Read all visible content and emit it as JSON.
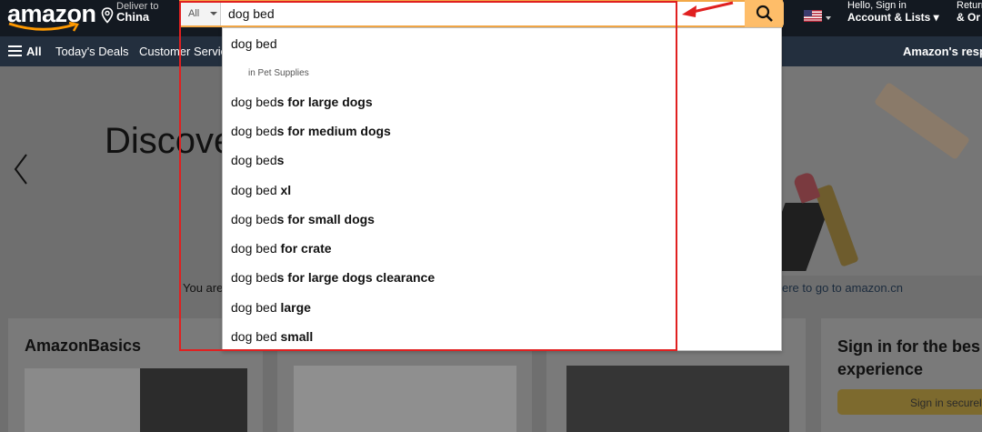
{
  "header": {
    "logo_text": "amazon",
    "deliver_label": "Deliver to",
    "deliver_location": "China",
    "search": {
      "category": "All",
      "value": "dog bed",
      "button_icon": "search-icon"
    },
    "flag_icon": "us-flag-icon",
    "account_line1": "Hello, Sign in",
    "account_line2": "Account & Lists",
    "returns_line1": "Return",
    "returns_line2": "& Or"
  },
  "nav": {
    "all_label": "All",
    "links": [
      "Today's Deals",
      "Customer Servic"
    ],
    "right_text": "Amazon's resp"
  },
  "hero": {
    "headline": "Discove",
    "left_text": "You are",
    "right_text": "ere to go to amazon.cn"
  },
  "cards": {
    "basics_title": "AmazonBasics",
    "signin_title": "Sign in for the bes experience",
    "signin_button": "Sign in securel"
  },
  "autocomplete": [
    {
      "prefix": "dog bed",
      "suffix": ""
    },
    {
      "sub": "in Pet Supplies"
    },
    {
      "prefix": "dog bed",
      "suffix": "s for large dogs"
    },
    {
      "prefix": "dog bed",
      "suffix": "s for medium dogs"
    },
    {
      "prefix": "dog bed",
      "suffix": "s"
    },
    {
      "prefix": "dog bed ",
      "suffix": "xl"
    },
    {
      "prefix": "dog bed",
      "suffix": "s for small dogs"
    },
    {
      "prefix": "dog bed ",
      "suffix": "for crate"
    },
    {
      "prefix": "dog bed",
      "suffix": "s for large dogs clearance"
    },
    {
      "prefix": "dog bed ",
      "suffix": "large"
    },
    {
      "prefix": "dog bed ",
      "suffix": "small"
    }
  ],
  "colors": {
    "nav_dark": "#131921",
    "nav_secondary": "#232f3e",
    "search_button": "#febd69",
    "highlight_box": "#e02020"
  }
}
